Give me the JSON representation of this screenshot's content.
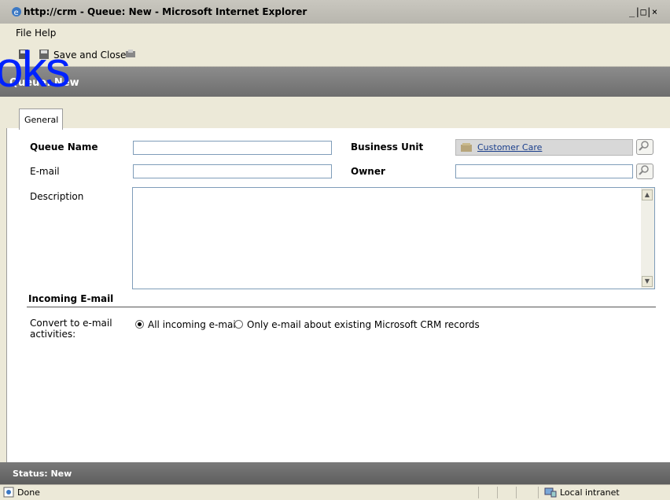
{
  "window": {
    "title": "http://crm - Queue: New - Microsoft Internet Explorer",
    "controls": "_|□|×"
  },
  "menu": {
    "file": "File",
    "help": "Help"
  },
  "toolbar": {
    "save_close_label": "Save and Close"
  },
  "overlay": {
    "watermark_text": "oks"
  },
  "header": {
    "crumb": "Queue: New"
  },
  "tabs": [
    {
      "label": "General"
    }
  ],
  "form": {
    "queue_name_label": "Queue Name",
    "queue_name_value": "",
    "email_label": "E-mail",
    "email_value": "",
    "business_unit_label": "Business Unit",
    "business_unit_value": "Customer Care",
    "owner_label": "Owner",
    "owner_value": "",
    "description_label": "Description",
    "description_value": ""
  },
  "incoming_email": {
    "section_title": "Incoming E-mail",
    "convert_label": "Convert to e-mail activities:",
    "option_all": "All incoming e-mail",
    "option_existing": "Only e-mail about existing Microsoft CRM records",
    "selected": "All incoming e-mail"
  },
  "status": {
    "label": "Status: New"
  },
  "browser_status": {
    "left": "Done",
    "zone": "Local intranet"
  },
  "colors": {
    "header_band": "#7a7a7a",
    "link": "#1a3e8c",
    "watermark_text": "#0022ff"
  }
}
